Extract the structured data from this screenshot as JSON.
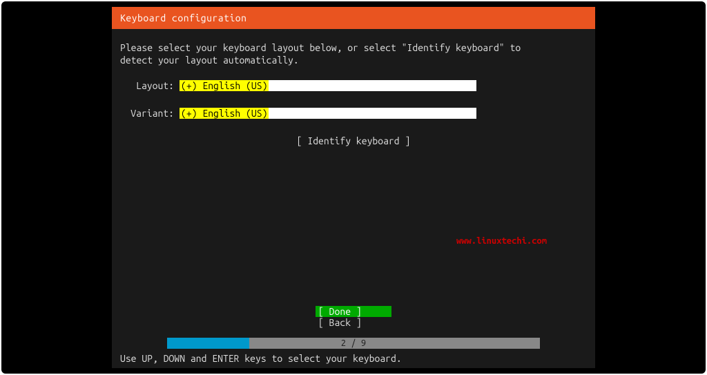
{
  "header": {
    "title": "Keyboard configuration"
  },
  "content": {
    "instructions": "Please select your keyboard layout below, or select \"Identify keyboard\" to\ndetect your layout automatically.",
    "layout_label": "Layout:",
    "layout_value": "(+) English (US)",
    "variant_label": "Variant:",
    "variant_value": "(+) English (US)",
    "identify_label": "[ Identify keyboard ]"
  },
  "watermark": "www.linuxtechi.com",
  "buttons": {
    "done": "[ Done       ]",
    "back": "[ Back       ]"
  },
  "progress": {
    "current": 2,
    "total": 9,
    "text": "2 / 9",
    "percent": 22
  },
  "hint": "Use UP, DOWN and ENTER keys to select your keyboard."
}
